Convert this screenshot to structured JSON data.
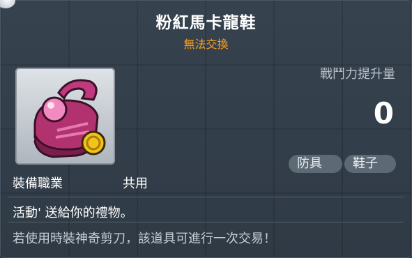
{
  "tooltip": {
    "item_name": "粉紅馬卡龍鞋",
    "trade_status": "無法交換",
    "item_icon": "pink-macaron-shoe-icon",
    "combat_power": {
      "label": "戰鬥力提升量",
      "value": "0"
    },
    "tags": [
      "防具",
      "鞋子"
    ],
    "job": {
      "label": "裝備職業",
      "value": "共用"
    },
    "description": "活動' 送給你的禮物。",
    "note": "若使用時裝神奇剪刀，該道具可進行一次交易！"
  },
  "colors": {
    "title": "#ffffff",
    "trade_status": "#ff9f1a",
    "background": "#323e49",
    "tag_bg": "#5d6975"
  }
}
